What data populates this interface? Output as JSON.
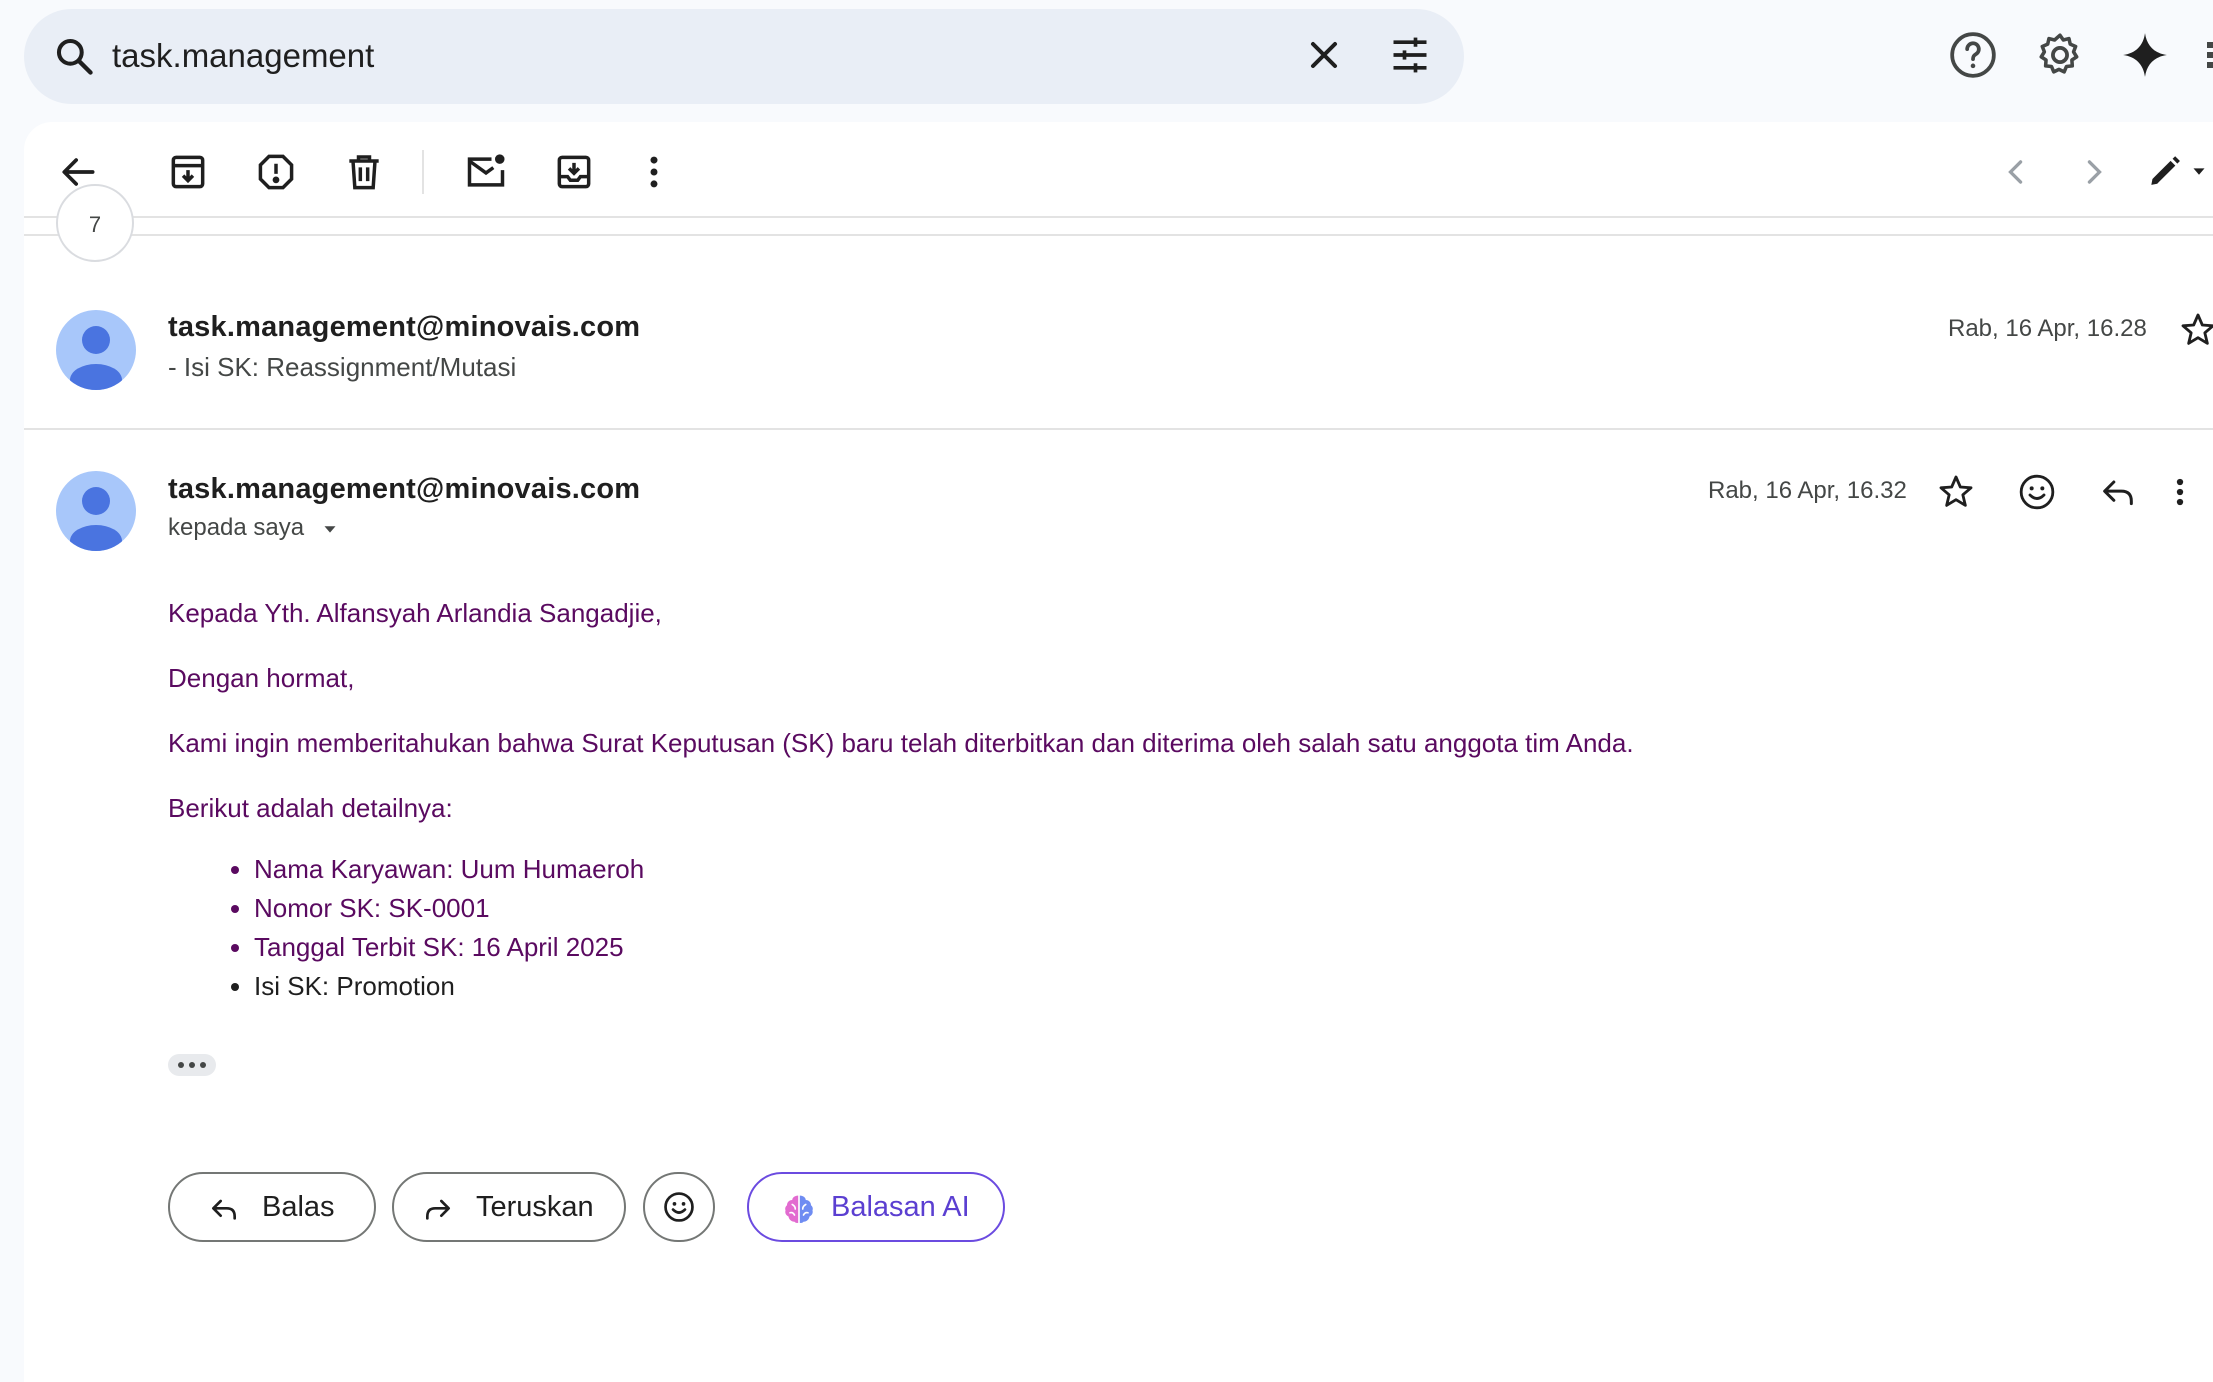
{
  "search": {
    "query": "task.management"
  },
  "toolbar": {
    "icons": [
      "back-arrow-icon",
      "archive-icon",
      "report-spam-icon",
      "delete-icon",
      "mark-unread-icon",
      "move-to-icon",
      "more-vert-icon",
      "prev-chevron-icon",
      "next-chevron-icon",
      "edit-pencil-icon"
    ]
  },
  "thread": {
    "collapsed_count": "7"
  },
  "message1": {
    "sender": "task.management@minovais.com",
    "snippet": "- Isi SK: Reassignment/Mutasi",
    "date": "Rab, 16 Apr, 16.28"
  },
  "message2": {
    "sender": "task.management@minovais.com",
    "recipient": "kepada saya",
    "date": "Rab, 16 Apr, 16.32",
    "greeting": "Kepada Yth. Alfansyah Arlandia Sangadjie,",
    "salutation": "Dengan hormat,",
    "intro": "Kami ingin memberitahukan bahwa Surat Keputusan (SK) baru telah diterbitkan dan diterima oleh salah satu anggota tim Anda.",
    "details_heading": "Berikut adalah detailnya:",
    "details": [
      "Nama Karyawan: Uum Humaeroh",
      "Nomor SK: SK-0001",
      "Tanggal Terbit SK: 16 April 2025",
      "Isi SK: Promotion"
    ]
  },
  "actions": {
    "reply": "Balas",
    "forward": "Teruskan",
    "ai_reply": "Balasan AI"
  },
  "colors": {
    "body_text": "#5a0a60",
    "avatar_bg": "#a8c7fa",
    "avatar_fg": "#4a74e0",
    "ai_accent": "#6b4be0"
  }
}
